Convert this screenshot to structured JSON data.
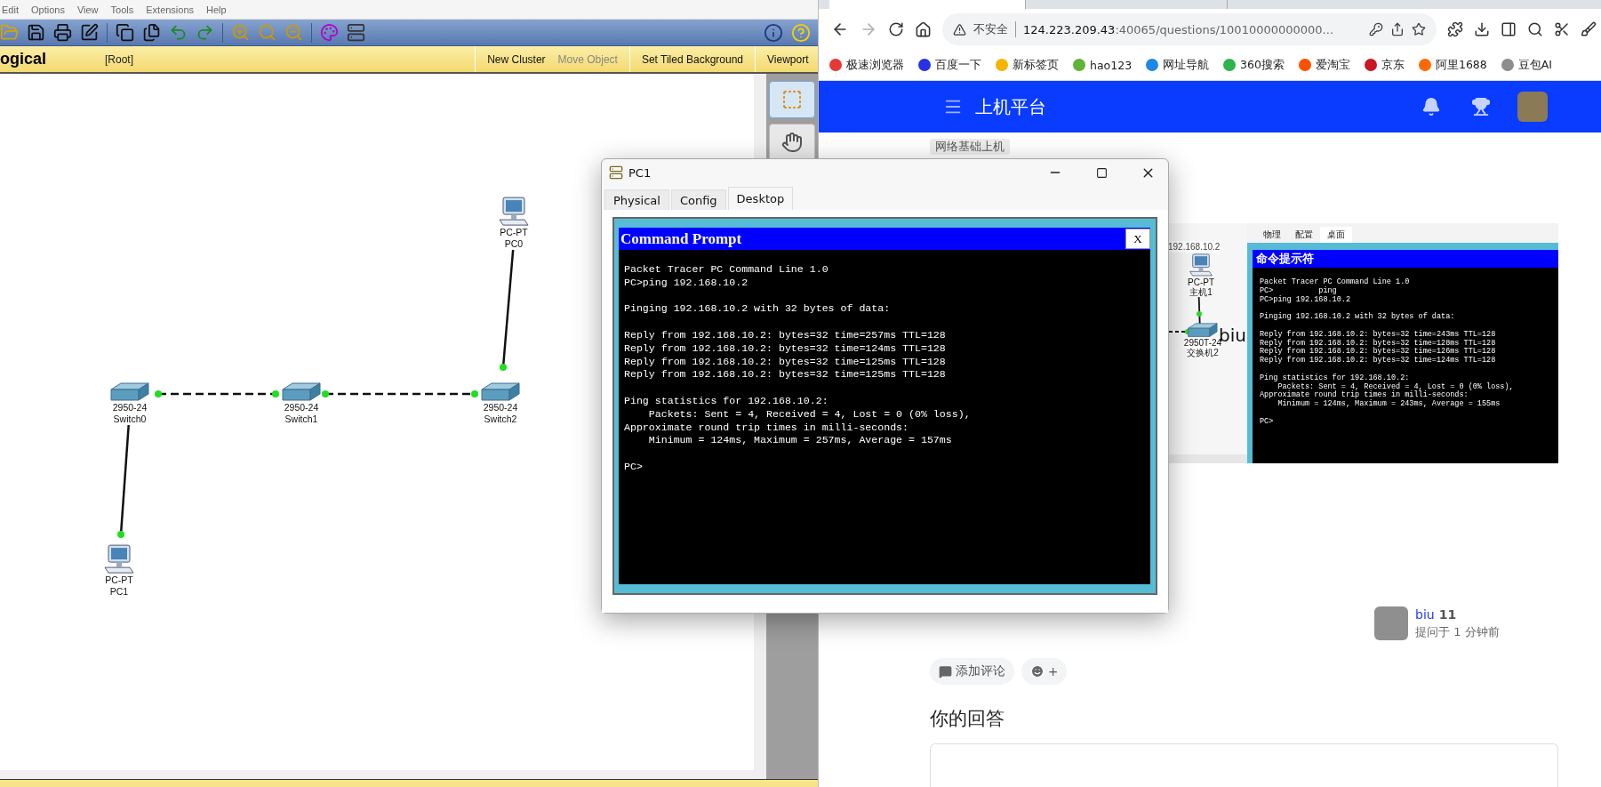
{
  "packet_tracer": {
    "menu": [
      "Edit",
      "Options",
      "View",
      "Tools",
      "Extensions",
      "Help"
    ],
    "workspace_bar": {
      "mode": "ogical",
      "path": "[Root]",
      "actions": [
        {
          "label": "New Cluster",
          "disabled": false
        },
        {
          "label": "Move Object",
          "disabled": true
        },
        {
          "label": "Set Tiled Background",
          "disabled": false
        }
      ],
      "viewport": "Viewport"
    },
    "tools": [
      {
        "kind": "select",
        "selected": true
      },
      {
        "kind": "hand",
        "selected": false
      }
    ],
    "devices": [
      {
        "kind": "pc",
        "model": "PC-PT",
        "name": "PC0"
      },
      {
        "kind": "switch",
        "model": "2950-24",
        "name": "Switch0"
      },
      {
        "kind": "switch",
        "model": "2950-24",
        "name": "Switch1"
      },
      {
        "kind": "switch",
        "model": "2950-24",
        "name": "Switch2"
      },
      {
        "kind": "pc",
        "model": "PC-PT",
        "name": "PC1"
      }
    ]
  },
  "pc_window": {
    "title": "PC1",
    "tabs": [
      {
        "label": "Physical",
        "selected": false
      },
      {
        "label": "Config",
        "selected": false
      },
      {
        "label": "Desktop",
        "selected": true
      }
    ],
    "prompt": {
      "title": "Command Prompt",
      "close": "X",
      "blocks": [
        [
          "Packet Tracer PC Command Line 1.0",
          "PC>ping 192.168.10.2"
        ],
        [
          "Pinging 192.168.10.2 with 32 bytes of data:"
        ],
        [
          "Reply from 192.168.10.2: bytes=32 time=257ms TTL=128",
          "Reply from 192.168.10.2: bytes=32 time=124ms TTL=128",
          "Reply from 192.168.10.2: bytes=32 time=125ms TTL=128",
          "Reply from 192.168.10.2: bytes=32 time=125ms TTL=128"
        ],
        [
          "Ping statistics for 192.168.10.2:",
          "    Packets: Sent = 4, Received = 4, Lost = 0 (0% loss),",
          "Approximate round trip times in milli-seconds:",
          "    Minimum = 124ms, Maximum = 257ms, Average = 157ms"
        ],
        [
          "PC>"
        ]
      ]
    }
  },
  "browser": {
    "forward_disabled": true,
    "address": {
      "security": "不安全",
      "host": "124.223.209.43",
      "path": ":40065/questions/10010000000000..."
    },
    "bookmarks": [
      {
        "label": "极速浏览器",
        "color": "#e53935"
      },
      {
        "label": "百度一下",
        "color": "#2932e1"
      },
      {
        "label": "新标签页",
        "color": "#f4b400"
      },
      {
        "label": "hao123",
        "color": "#5fb336"
      },
      {
        "label": "网址导航",
        "color": "#1e88e5"
      },
      {
        "label": "360搜索",
        "color": "#2fb34a"
      },
      {
        "label": "爱淘宝",
        "color": "#ff5000"
      },
      {
        "label": "京东",
        "color": "#c91623"
      },
      {
        "label": "阿里1688",
        "color": "#ff6a00"
      },
      {
        "label": "豆包AI",
        "color": "#8d8d8d"
      }
    ]
  },
  "site": {
    "title": "上机平台",
    "tag": "网络基础上机",
    "question_image": {
      "network": {
        "ip": "192.168.10.2",
        "pc_model": "PC-PT",
        "pc_name": "主机1",
        "switch_model": "2950T-24",
        "switch_name": "交换机2"
      },
      "tabs": [
        {
          "label": "物理",
          "selected": false
        },
        {
          "label": "配置",
          "selected": false
        },
        {
          "label": "桌面",
          "selected": true
        }
      ],
      "prompt_title": "命令提示符",
      "blocks": [
        [
          "Packet Tracer PC Command Line 1.0",
          "PC>          ping",
          "PC>ping 192.168.10.2"
        ],
        [
          "Pinging 192.168.10.2 with 32 bytes of data:"
        ],
        [
          "Reply from 192.168.10.2: bytes=32 time=243ms TTL=128",
          "Reply from 192.168.10.2: bytes=32 time=128ms TTL=128",
          "Reply from 192.168.10.2: bytes=32 time=126ms TTL=128",
          "Reply from 192.168.10.2: bytes=32 time=124ms TTL=128"
        ],
        [
          "Ping statistics for 192.168.10.2:",
          "    Packets: Sent = 4, Received = 4, Lost = 0 (0% loss),",
          "Approximate round trip times in milli-seconds:",
          "    Minimum = 124ms, Maximum = 243ms, Average = 155ms"
        ],
        [
          "PC>"
        ]
      ]
    },
    "overlay_text": "biu",
    "asker": {
      "name": "biu",
      "badge": "11",
      "time": "提问于 1 分钟前"
    },
    "comment_button": "添加评论",
    "reaction_button": "+",
    "answer_heading": "你的回答"
  }
}
